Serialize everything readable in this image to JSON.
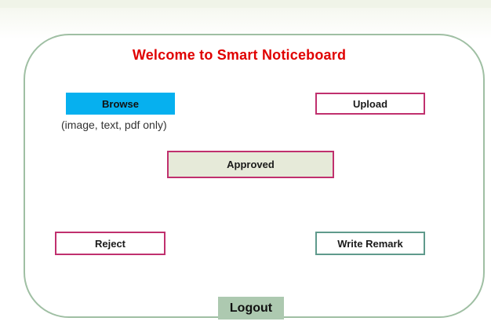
{
  "title": "Welcome to Smart Noticeboard",
  "actions": {
    "browse_label": "Browse",
    "file_hint": "(image, text, pdf only)",
    "upload_label": "Upload",
    "approved_label": "Approved",
    "reject_label": "Reject",
    "write_remark_label": "Write Remark",
    "logout_label": "Logout"
  },
  "colors": {
    "title": "#e00000",
    "browse_fill": "#06b0ef",
    "accent_border": "#c0306e",
    "remark_border": "#5f9a8c",
    "logout_fill": "#adc9b0",
    "panel_border": "#9fbfa3"
  }
}
